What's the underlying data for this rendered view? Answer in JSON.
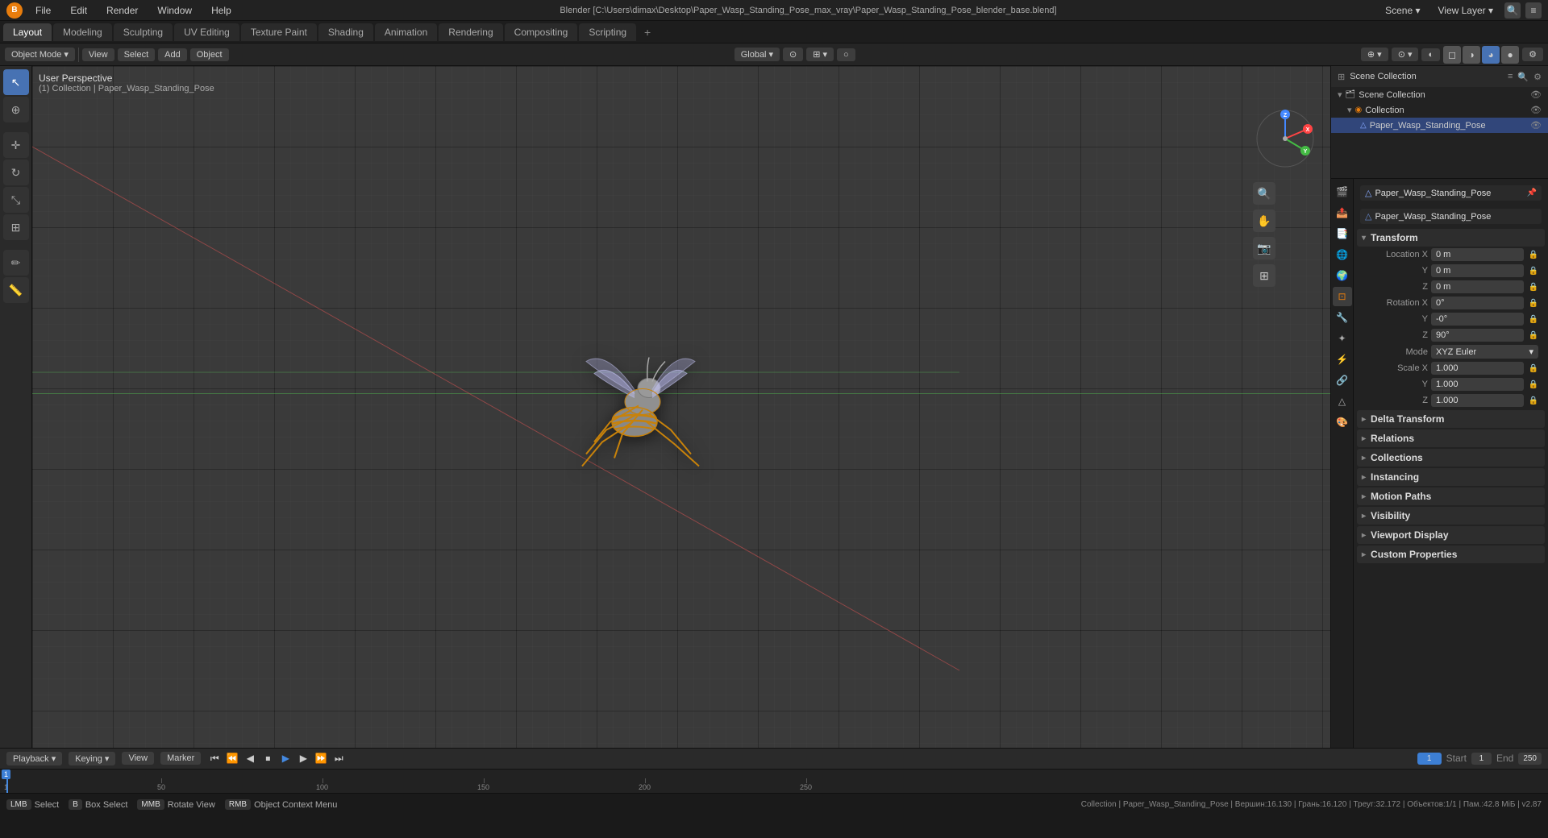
{
  "titlebar": {
    "title": "Blender [C:\\Users\\dimax\\Desktop\\Paper_Wasp_Standing_Pose_max_vray\\Paper_Wasp_Standing_Pose_blender_base.blend]",
    "logo": "B",
    "menus": [
      "Blender",
      "File",
      "Edit",
      "Render",
      "Window",
      "Help"
    ]
  },
  "workspace_tabs": {
    "tabs": [
      "Layout",
      "Modeling",
      "Sculpting",
      "UV Editing",
      "Texture Paint",
      "Shading",
      "Animation",
      "Rendering",
      "Compositing",
      "Scripting",
      "+"
    ],
    "active": "Layout"
  },
  "viewport_header": {
    "mode": "Object Mode",
    "view_label": "View",
    "select_label": "Select",
    "add_label": "Add",
    "object_label": "Object",
    "global_label": "Global",
    "transform_icons": [
      "⊕",
      "⊙",
      "⊞"
    ],
    "viewport_shading_icons": [
      "◐",
      "◑",
      "●",
      "○"
    ]
  },
  "viewport": {
    "perspective_label": "User Perspective",
    "collection_info": "(1) Collection | Paper_Wasp_Standing_Pose"
  },
  "outliner": {
    "header": "Scene Collection",
    "items": [
      {
        "label": "Collection",
        "type": "collection",
        "indent": 0,
        "expanded": true
      },
      {
        "label": "Paper_Wasp_Standing_Pose",
        "type": "mesh",
        "indent": 1,
        "selected": true
      }
    ]
  },
  "properties": {
    "active_object": "Paper_Wasp_Standing_Pose",
    "object_name": "Paper_Wasp_Standing_Pose",
    "transform": {
      "header": "Transform",
      "location_x": "0 m",
      "location_y": "0 m",
      "location_z": "0 m",
      "rotation_x": "0°",
      "rotation_y": "-0°",
      "rotation_z": "90°",
      "mode_label": "Mode",
      "mode_value": "XYZ Euler",
      "scale_x": "1.000",
      "scale_y": "1.000",
      "scale_z": "1.000"
    },
    "sections": [
      {
        "id": "delta-transform",
        "label": "Delta Transform",
        "collapsed": true
      },
      {
        "id": "relations",
        "label": "Relations",
        "collapsed": true
      },
      {
        "id": "collections",
        "label": "Collections",
        "collapsed": true
      },
      {
        "id": "instancing",
        "label": "Instancing",
        "collapsed": true
      },
      {
        "id": "motion-paths",
        "label": "Motion Paths",
        "collapsed": true
      },
      {
        "id": "visibility",
        "label": "Visibility",
        "collapsed": true
      },
      {
        "id": "viewport-display",
        "label": "Viewport Display",
        "collapsed": true
      },
      {
        "id": "custom-properties",
        "label": "Custom Properties",
        "collapsed": true
      }
    ],
    "prop_icons": [
      "🎬",
      "🔗",
      "📐",
      "🎨",
      "💡",
      "📷",
      "🌊",
      "⚙️",
      "🔲"
    ]
  },
  "timeline": {
    "playback_label": "Playback",
    "keying_label": "Keying",
    "view_label": "View",
    "marker_label": "Marker",
    "current_frame": "1",
    "start_frame": "1",
    "end_frame": "250",
    "frame_markers": [
      1,
      50,
      100,
      150,
      200,
      250
    ],
    "play_controls": [
      "⏮",
      "⏮",
      "◀",
      "◀|",
      "▶",
      "▶|",
      "⏭",
      "⏭"
    ]
  },
  "statusbar": {
    "select_label": "Select",
    "box_select_label": "Box Select",
    "rotate_view_label": "Rotate View",
    "object_context_label": "Object Context Menu",
    "collection_info": "Collection | Paper_Wasp_Standing_Pose | Вершин:16.130 | Грань:16.120 | Треуг:32.172 | Объектов:1/1 | Пам.:42.8 МіБ | v2.87"
  },
  "colors": {
    "accent": "#e87d0d",
    "selected": "#4772b3",
    "panel_bg": "#222222",
    "toolbar_bg": "#2a2a2a",
    "viewport_bg": "#3a3a3a",
    "grid_line": "#444444",
    "active_tab": "#3d3d3d"
  }
}
